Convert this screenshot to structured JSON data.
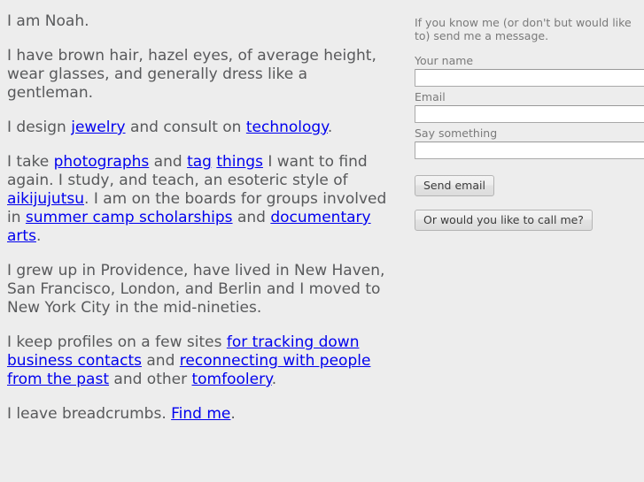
{
  "bio": {
    "paragraphs": [
      {
        "id": "intro-name",
        "segments": [
          {
            "type": "text",
            "text": "I am Noah."
          }
        ]
      },
      {
        "id": "appearance",
        "segments": [
          {
            "type": "text",
            "text": "I have brown hair, hazel eyes, of average height, wear glasses, and generally dress like a gentleman."
          }
        ]
      },
      {
        "id": "work",
        "segments": [
          {
            "type": "text",
            "text": "I design "
          },
          {
            "type": "link",
            "text": "jewelry"
          },
          {
            "type": "text",
            "text": " and consult on "
          },
          {
            "type": "link",
            "text": "technology"
          },
          {
            "type": "text",
            "text": "."
          }
        ]
      },
      {
        "id": "hobbies",
        "segments": [
          {
            "type": "text",
            "text": "I take "
          },
          {
            "type": "link",
            "text": "photographs"
          },
          {
            "type": "text",
            "text": " and "
          },
          {
            "type": "link",
            "text": "tag"
          },
          {
            "type": "text",
            "text": " "
          },
          {
            "type": "link",
            "text": "things"
          },
          {
            "type": "text",
            "text": " I want to find again. I study, and teach, an esoteric style of "
          },
          {
            "type": "link",
            "text": "aikijujutsu"
          },
          {
            "type": "text",
            "text": ". I am on the boards for groups involved in "
          },
          {
            "type": "link",
            "text": "summer camp scholarships"
          },
          {
            "type": "text",
            "text": " and "
          },
          {
            "type": "link",
            "text": "documentary arts"
          },
          {
            "type": "text",
            "text": "."
          }
        ]
      },
      {
        "id": "geography",
        "segments": [
          {
            "type": "text",
            "text": "I grew up in Providence, have lived in New Haven, San Francisco, London, and Berlin and I moved to New York City in the mid-nineties."
          }
        ]
      },
      {
        "id": "profiles",
        "segments": [
          {
            "type": "text",
            "text": "I keep profiles on a few sites "
          },
          {
            "type": "link",
            "text": "for tracking down business contacts"
          },
          {
            "type": "text",
            "text": " and "
          },
          {
            "type": "link",
            "text": "reconnecting with people from the past"
          },
          {
            "type": "text",
            "text": " and other "
          },
          {
            "type": "link",
            "text": "tomfoolery"
          },
          {
            "type": "text",
            "text": "."
          }
        ]
      },
      {
        "id": "breadcrumbs",
        "segments": [
          {
            "type": "text",
            "text": "I leave breadcrumbs. "
          },
          {
            "type": "link",
            "text": "Find me"
          },
          {
            "type": "text",
            "text": "."
          }
        ]
      }
    ]
  },
  "contact": {
    "intro": "If you know me (or don't but would like to) send me a message.",
    "fields": [
      {
        "label": "Your name",
        "value": "",
        "placeholder": ""
      },
      {
        "label": "Email",
        "value": "",
        "placeholder": ""
      },
      {
        "label": "Say something",
        "value": "",
        "placeholder": ""
      }
    ],
    "send_button": "Send email",
    "call_button": "Or would you like to call me?"
  },
  "colors": {
    "background": "#ededed",
    "body_text": "#58595b",
    "muted_text": "#7a7a7a",
    "link": "#0000ee",
    "input_background": "#ffffff",
    "input_border": "#a9a9a9",
    "button_text": "#3c3c3c"
  }
}
